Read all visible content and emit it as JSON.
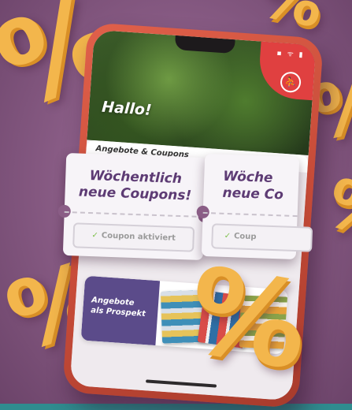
{
  "screen": {
    "greeting": "Hallo!",
    "section_title": "Angebote & Coupons",
    "status_icons": "▪ ᯤ ▮",
    "user_icon": "user-icon"
  },
  "coupons": [
    {
      "title_line1": "Wöchentlich",
      "title_line2": "neue Coupons!",
      "button_label": "Coupon aktiviert"
    },
    {
      "title_line1": "Wöche",
      "title_line2": "neue Co",
      "button_label": "Coup"
    }
  ],
  "prospekt": {
    "label_line1": "Angebote",
    "label_line2": "als Prospekt"
  },
  "decor": {
    "percent_symbol": "%"
  },
  "colors": {
    "background": "#8a5d86",
    "percent_orange": "#f3b64c",
    "phone_red": "#d4553f",
    "coupon_purple": "#5d3b74",
    "check_green": "#7cbf4a",
    "prospekt_purple": "#5b4b8a"
  }
}
